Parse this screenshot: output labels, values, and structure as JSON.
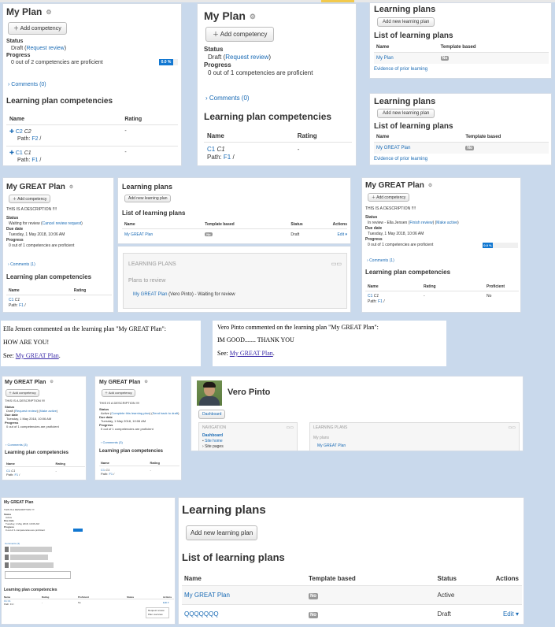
{
  "p1": {
    "title": "My Plan",
    "add_btn": "Add competency",
    "status_label": "Status",
    "status_value": "Draft",
    "request_review": "Request review",
    "progress_label": "Progress",
    "progress_text": "0 out of 2 competencies are proficient",
    "progress_pct": "0.0 %",
    "comments": "Comments (0)",
    "section": "Learning plan competencies",
    "col_name": "Name",
    "col_rating": "Rating",
    "rows": [
      {
        "code": "C2",
        "name": "C2",
        "path_label": "Path:",
        "path": "F2",
        "rating": "-"
      },
      {
        "code": "C1",
        "name": "C1",
        "path_label": "Path:",
        "path": "F1",
        "rating": "-"
      }
    ]
  },
  "p2": {
    "title": "My Plan",
    "add_btn": "Add competency",
    "status_label": "Status",
    "status_value": "Draft",
    "request_review": "Request review",
    "progress_label": "Progress",
    "progress_text": "0 out of 1 competencies are proficient",
    "comments": "Comments (0)",
    "section": "Learning plan competencies",
    "col_name": "Name",
    "col_rating": "Rating",
    "row_code": "C1",
    "row_name": "C1",
    "row_path_label": "Path:",
    "row_path": "F1",
    "row_rating": "-"
  },
  "p3": {
    "title": "Learning plans",
    "add_btn": "Add new learning plan",
    "list_title": "List of learning plans",
    "col_name": "Name",
    "col_template": "Template based",
    "row_name": "My Plan",
    "row_template": "No",
    "evidence": "Evidence of prior learning"
  },
  "p4": {
    "title": "Learning plans",
    "add_btn": "Add new learning plan",
    "list_title": "List of learning plans",
    "col_name": "Name",
    "col_template": "Template based",
    "row_name": "My GREAT Plan",
    "row_template": "No",
    "evidence": "Evidence of prior learning"
  },
  "p5": {
    "title": "My GREAT Plan",
    "add_btn": "Add competency",
    "desc": "THIS IS A DESCRIPTION !!!!",
    "status_label": "Status",
    "status_value": "Waiting for review",
    "cancel_review": "Cancel review request",
    "due_label": "Due date",
    "due_value": "Tuesday, 1 May 2018, 10:06 AM",
    "progress_label": "Progress",
    "progress_text": "0 out of 1 competencies are proficient",
    "comments": "Comments (1)",
    "section": "Learning plan competencies",
    "col_name": "Name",
    "col_rating": "Rating",
    "row_code": "C1",
    "row_name": "C1",
    "row_path_label": "Path:",
    "row_path": "F1",
    "row_rating": "-"
  },
  "p6": {
    "title": "Learning plans",
    "add_btn": "Add new learning plan",
    "list_title": "List of learning plans",
    "col_name": "Name",
    "col_template": "Template based",
    "col_status": "Status",
    "col_actions": "Actions",
    "row_name": "My GREAT Plan",
    "row_template": "No",
    "row_status": "Draft",
    "row_action": "Edit"
  },
  "p7": {
    "block_title": "LEARNING PLANS",
    "subtitle": "Plans to review",
    "plan": "My GREAT Plan",
    "plan_note": "(Vero Pinto) - Waiting for review"
  },
  "p8": {
    "title": "My GREAT Plan",
    "add_btn": "Add competency",
    "desc": "THIS IS A DESCRIPTION !!!!",
    "status_label": "Status",
    "status_value": "In review - Ella Jensen",
    "finish_review": "Finish review",
    "make_active": "Make active",
    "due_label": "Due date",
    "due_value": "Tuesday, 1 May 2018, 10:06 AM",
    "progress_label": "Progress",
    "progress_text": "0 out of 1 competencies are proficient",
    "progress_pct": "0.0 %",
    "comments": "Comments (1)",
    "section": "Learning plan competencies",
    "col_name": "Name",
    "col_rating": "Rating",
    "col_proficient": "Proficient",
    "row_code": "C1",
    "row_name": "C1",
    "row_path_label": "Path:",
    "row_path": "F1",
    "row_rating": "-",
    "row_proficient": "No"
  },
  "p9": {
    "line1": "Ella Jensen commented on the learning plan \"My GREAT Plan\":",
    "line2": "HOW ARE YOU!",
    "see": "See:",
    "link": "My GREAT Plan",
    "dot": "."
  },
  "p10": {
    "line1": "Vero Pinto commented on the learning plan \"My GREAT Plan\":",
    "line2": "IM GOOD....... THANK YOU",
    "see": "See:",
    "link": "My GREAT Plan",
    "dot": "."
  },
  "p11": {
    "title": "My GREAT Plan",
    "add_btn": "Add competency",
    "desc": "THIS IS A DESCRIPTION !!!!",
    "status_label": "Status",
    "status_value": "Draft",
    "request_review": "Request review",
    "make_active": "Make active",
    "due_label": "Due date",
    "due_value": "Tuesday, 1 May 2018, 10:06 AM",
    "progress_label": "Progress",
    "progress_text": "0 out of 1 competencies are proficient",
    "comments": "Comments (3)",
    "section": "Learning plan competencies",
    "col_name": "Name",
    "col_rating": "Rating",
    "row_code": "C1",
    "row_name": "C1",
    "row_path_label": "Path:",
    "row_path": "F1",
    "row_rating": "-"
  },
  "p12": {
    "title": "My GREAT Plan",
    "add_btn": "Add competency",
    "desc": "THIS IS A DESCRIPTION !!!!",
    "status_label": "Status",
    "status_value": "Active",
    "complete_plan": "Complete this learning plan",
    "send_back": "Send back to draft",
    "due_label": "Due date",
    "due_value": "Tuesday, 1 May 2018, 10:06 AM",
    "progress_label": "Progress",
    "progress_text": "0 out of 1 competencies are proficient",
    "comments": "Comments (3)",
    "section": "Learning plan competencies",
    "col_name": "Name",
    "col_rating": "Rating",
    "row_code": "C1",
    "row_name": "C1",
    "row_path_label": "Path:",
    "row_path": "F1",
    "row_rating": "-"
  },
  "p13": {
    "name": "Vero Pinto",
    "dashboard_btn": "Dashboard",
    "nav_title": "NAVIGATION",
    "nav_dashboard": "Dashboard",
    "nav_site_home": "Site home",
    "nav_site_pages": "Site pages",
    "lp_title": "LEARNING PLANS",
    "lp_subtitle": "My plans",
    "lp_plan": "My GREAT Plan"
  },
  "p14": {
    "title": "My GREAT Plan",
    "desc": "THIS IS A DESCRIPTION !!!!",
    "status_label": "Status",
    "status_value": "Active",
    "due_label": "Due date",
    "due_value": "Tuesday, 1 May 2018, 10:06 AM",
    "progress_label": "Progress",
    "progress_text": "0 out of 1 competencies are proficient",
    "comments": "Comments (3)",
    "section": "Learning plan competencies",
    "col_name": "Name",
    "col_rating": "Rating",
    "col_proficient": "Proficient",
    "col_status": "Status",
    "col_actions": "Actions",
    "row_code": "C1 C1",
    "row_path": "Path: F1 /",
    "row_rating": "-",
    "row_proficient": "No",
    "row_action": "Edit",
    "menu_1": "Request review",
    "menu_2": "Plan overview"
  },
  "p15": {
    "title": "Learning plans",
    "add_btn": "Add new learning plan",
    "list_title": "List of learning plans",
    "col_name": "Name",
    "col_template": "Template based",
    "col_status": "Status",
    "col_actions": "Actions",
    "rows": [
      {
        "name": "My GREAT Plan",
        "template": "No",
        "status": "Active",
        "action": ""
      },
      {
        "name": "QQQQQQQ",
        "template": "No",
        "status": "Draft",
        "action": "Edit"
      }
    ]
  },
  "colors": {
    "link": "#1a6bb5",
    "accent": "#1177d1",
    "badge": "#999999",
    "background": "#c9d9ec"
  }
}
